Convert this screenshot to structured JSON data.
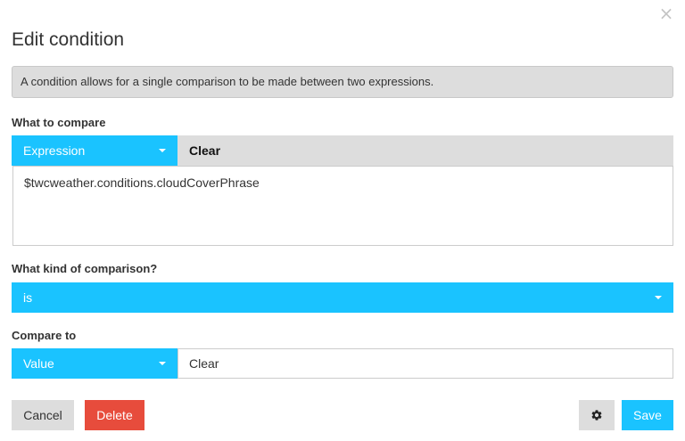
{
  "dialog": {
    "title": "Edit condition",
    "close_symbol": "×",
    "info": "A condition allows for a single comparison to be made between two expressions."
  },
  "what_to_compare": {
    "label": "What to compare",
    "type_selected": "Expression",
    "clear_tab": "Clear",
    "expression_value": "$twcweather.conditions.cloudCoverPhrase"
  },
  "comparison": {
    "label": "What kind of comparison?",
    "selected": "is"
  },
  "compare_to": {
    "label": "Compare to",
    "type_selected": "Value",
    "value": "Clear"
  },
  "footer": {
    "cancel_label": "Cancel",
    "delete_label": "Delete",
    "settings_icon": "gear-icon",
    "save_label": "Save"
  },
  "colors": {
    "accent": "#1ac3ff",
    "danger": "#e74c3c",
    "neutral": "#dddddd"
  }
}
